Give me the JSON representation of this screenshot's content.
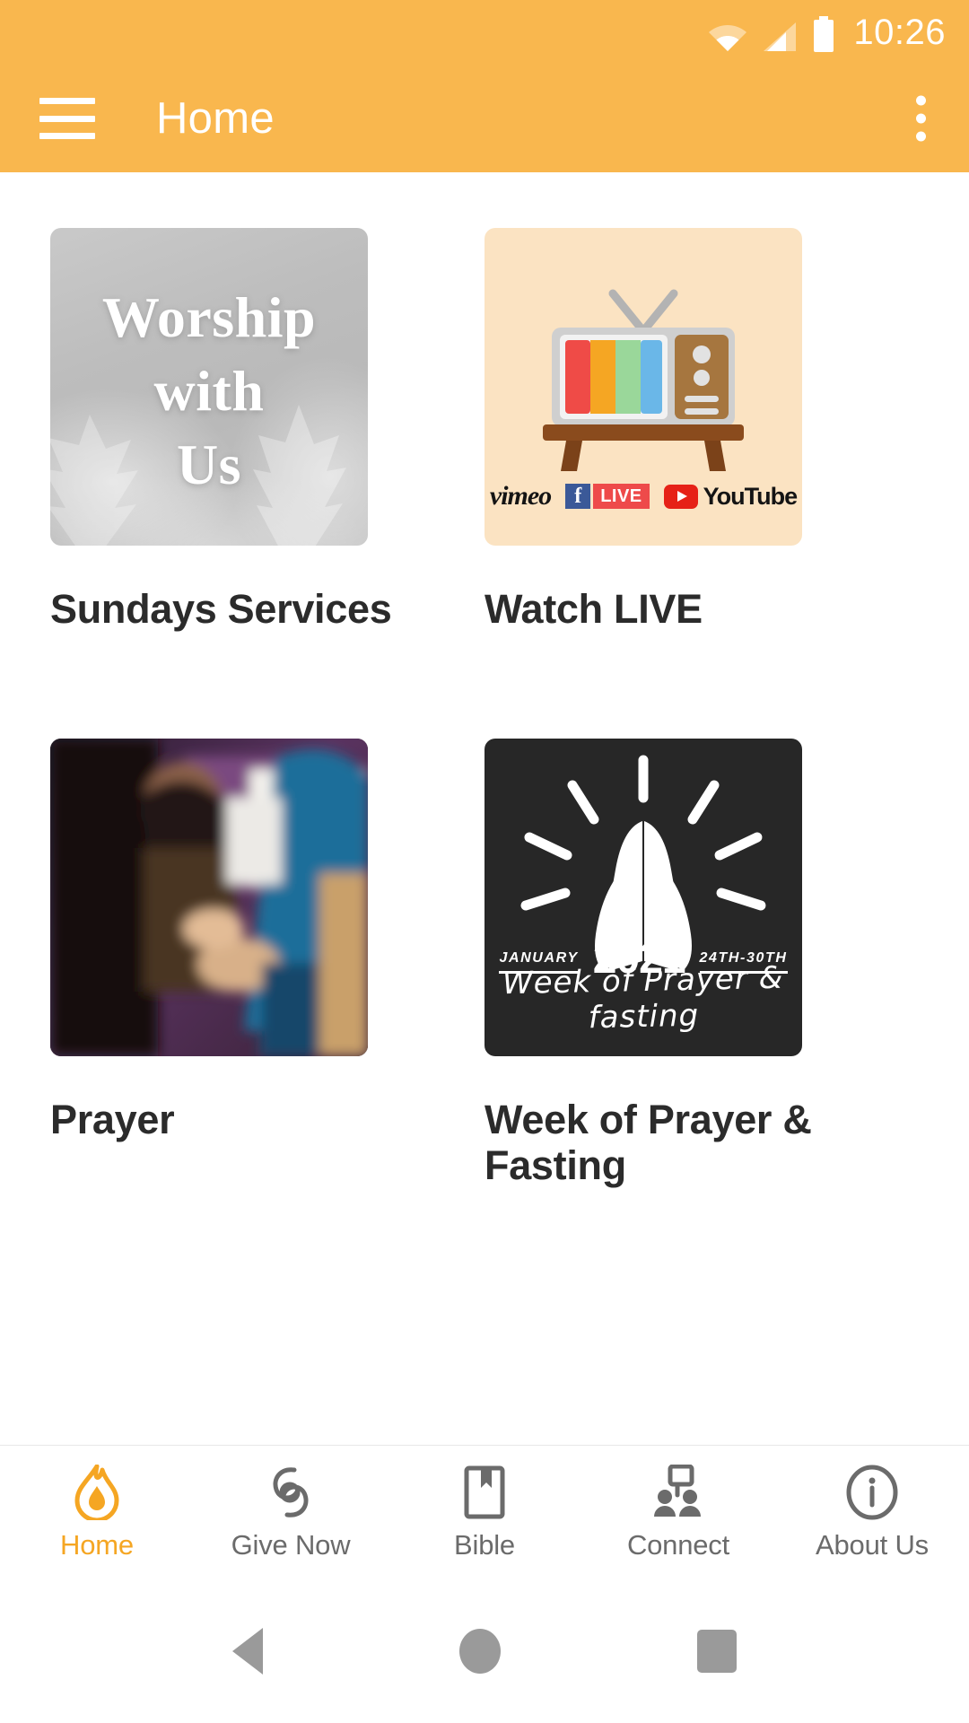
{
  "status_bar": {
    "time": "10:26",
    "icons": [
      "wifi-icon",
      "cellular-signal-icon",
      "battery-icon"
    ]
  },
  "app_bar": {
    "menu_icon": "hamburger-menu-icon",
    "title": "Home",
    "overflow_icon": "overflow-menu-icon"
  },
  "theme": {
    "accent": "#F9B74E",
    "active_tab": "#F5A623",
    "title_text": "#2b2b2b",
    "label_text": "#6b6b6b",
    "live_card_bg": "#FBE3C2",
    "dark_card_bg": "#272727"
  },
  "cards": [
    {
      "id": "sundays-services",
      "title": "Sundays Services",
      "image_kind": "photo-grayscale-forest",
      "overlay_lines": [
        "Worship",
        "with",
        "Us"
      ]
    },
    {
      "id": "watch-live",
      "title": "Watch LIVE",
      "image_kind": "illustration-retro-tv",
      "platforms": [
        {
          "name": "vimeo",
          "label": "vimeo"
        },
        {
          "name": "facebook-live",
          "label": "LIVE",
          "mark": "f"
        },
        {
          "name": "youtube",
          "label": "YouTube"
        }
      ]
    },
    {
      "id": "prayer",
      "title": "Prayer",
      "image_kind": "photo-people-praying"
    },
    {
      "id": "week-of-prayer-fasting",
      "title": "Week of Prayer & Fasting",
      "image_kind": "graphic-praying-hands",
      "month": "JANUARY",
      "year": "2021",
      "dates": "24TH-30TH",
      "script_line": "Week of Prayer & fasting"
    }
  ],
  "bottom_nav": {
    "items": [
      {
        "label": "Home",
        "icon": "flame-icon",
        "active": true
      },
      {
        "label": "Give Now",
        "icon": "giving-hands-icon",
        "active": false
      },
      {
        "label": "Bible",
        "icon": "book-bookmark-icon",
        "active": false
      },
      {
        "label": "Connect",
        "icon": "people-chat-icon",
        "active": false
      },
      {
        "label": "About Us",
        "icon": "info-circle-icon",
        "active": false
      }
    ]
  },
  "android_nav": {
    "back": "back-triangle-icon",
    "home": "home-circle-icon",
    "recents": "recents-square-icon"
  }
}
